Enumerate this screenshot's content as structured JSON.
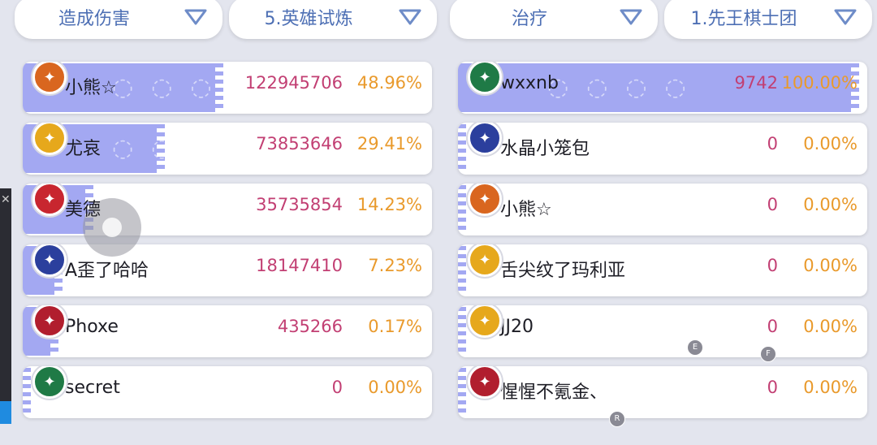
{
  "left_panel": {
    "type_dropdown": "造成伤害",
    "scope_dropdown": "5.英雄试炼",
    "rows": [
      {
        "name": "小熊☆",
        "value": "122945706",
        "percent": "48.96%",
        "share": 0.49,
        "badge_color": "#d9661f",
        "badge_icon": "flame-sigil-icon"
      },
      {
        "name": "尤哀",
        "value": "73853646",
        "percent": "29.41%",
        "share": 0.34,
        "badge_color": "#e6a81c",
        "badge_icon": "lightning-sigil-icon"
      },
      {
        "name": "美德",
        "value": "35735854",
        "percent": "14.23%",
        "share": 0.16,
        "badge_color": "#c8262f",
        "badge_icon": "crown-sigil-icon"
      },
      {
        "name": "A歪了哈哈",
        "value": "18147410",
        "percent": "7.23%",
        "share": 0.08,
        "badge_color": "#2b3f9d",
        "badge_icon": "book-sigil-icon"
      },
      {
        "name": "Phoxe",
        "value": "435266",
        "percent": "0.17%",
        "share": 0.07,
        "badge_color": "#b11e2e",
        "badge_icon": "wing-sigil-icon"
      },
      {
        "name": "secret",
        "value": "0",
        "percent": "0.00%",
        "share": 0,
        "badge_color": "#1f7a46",
        "badge_icon": "leaf-sigil-icon"
      }
    ]
  },
  "right_panel": {
    "type_dropdown": "治疗",
    "scope_dropdown": "1.先王棋士团",
    "rows": [
      {
        "name": "wxxnb",
        "value": "9742",
        "percent": "100.00%",
        "share": 1.0,
        "badge_color": "#1f7a46",
        "badge_icon": "leaf-sigil-icon"
      },
      {
        "name": "水晶小笼包",
        "value": "0",
        "percent": "0.00%",
        "share": 0,
        "badge_color": "#2b3f9d",
        "badge_icon": "book-sigil-icon"
      },
      {
        "name": "小熊☆",
        "value": "0",
        "percent": "0.00%",
        "share": 0,
        "badge_color": "#d9661f",
        "badge_icon": "flame-sigil-icon"
      },
      {
        "name": "舌尖纹了玛利亚",
        "value": "0",
        "percent": "0.00%",
        "share": 0,
        "badge_color": "#e6a81c",
        "badge_icon": "lightning-sigil-icon"
      },
      {
        "name": "JJ20",
        "value": "0",
        "percent": "0.00%",
        "share": 0,
        "badge_color": "#e6a81c",
        "badge_icon": "sword-sigil-icon"
      },
      {
        "name": "惺惺不氪金、",
        "value": "0",
        "percent": "0.00%",
        "share": 0,
        "badge_color": "#b11e2e",
        "badge_icon": "gate-sigil-icon"
      }
    ]
  },
  "overlay": {
    "key_e": "E",
    "key_f": "F",
    "key_r": "R"
  },
  "colors": {
    "bar": "#a3a8f2",
    "value": "#c23f73",
    "percent": "#e99a2c",
    "dropdown_text": "#4d6fb4"
  }
}
